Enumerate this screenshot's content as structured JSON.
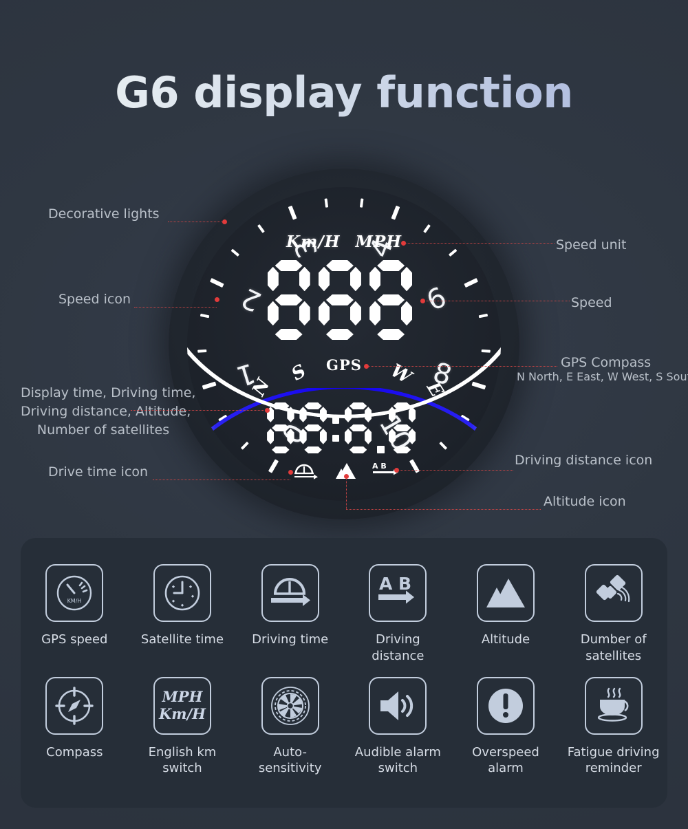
{
  "title": "G6 display function",
  "gauge": {
    "scale_numbers": [
      "0",
      "1",
      "2",
      "3",
      "4",
      "6",
      "8",
      "10"
    ],
    "unit_kmh": "Km/H",
    "unit_mph": "MPH",
    "speed_value": "888",
    "gps_label": "GPS",
    "compass": {
      "n": "N",
      "s": "S",
      "w": "W",
      "e": "E"
    },
    "secondary_value": "88:8.8",
    "mini_icons": [
      "drive-time-icon",
      "altitude-icon",
      "driving-distance-icon"
    ]
  },
  "annotations": {
    "decorative_lights": "Decorative lights",
    "speed_icon": "Speed icon",
    "display_time_block": [
      "Display time, Driving time,",
      "Driving distance, Altitude,",
      "Number of satellites"
    ],
    "drive_time_icon": "Drive time icon",
    "speed_unit": "Speed unit",
    "speed": "Speed",
    "gps_compass": "GPS Compass",
    "gps_compass_sub": "N North, E East, W West, S South",
    "driving_distance_icon": "Driving distance icon",
    "altitude_icon": "Altitude icon"
  },
  "features": [
    {
      "label": "GPS speed",
      "icon": "gps-speedometer-icon",
      "badge": "KM/H"
    },
    {
      "label": "Satellite time",
      "icon": "clock-icon"
    },
    {
      "label": "Driving time",
      "icon": "driving-time-icon"
    },
    {
      "label": "Driving distance",
      "icon": "ab-distance-icon",
      "badge": "A B"
    },
    {
      "label": "Altitude",
      "icon": "mountain-icon"
    },
    {
      "label": "Dumber of satellites",
      "icon": "satellite-icon"
    },
    {
      "label": "Compass",
      "icon": "compass-icon"
    },
    {
      "label": "English km switch",
      "icon": "mph-kmh-switch-icon",
      "badge_top": "MPH",
      "badge_bottom": "Km/H"
    },
    {
      "label": "Auto-sensitivity",
      "icon": "turbine-aperture-icon"
    },
    {
      "label": "Audible alarm switch",
      "icon": "speaker-icon"
    },
    {
      "label": "Overspeed alarm",
      "icon": "exclamation-circle-icon"
    },
    {
      "label": "Fatigue driving reminder",
      "icon": "coffee-cup-icon"
    }
  ],
  "colors": {
    "background": "#2e3642",
    "panel": "#262e38",
    "accent_blue": "#1200ee",
    "lead_red": "#d04545",
    "text_muted": "#b9c0c9"
  }
}
